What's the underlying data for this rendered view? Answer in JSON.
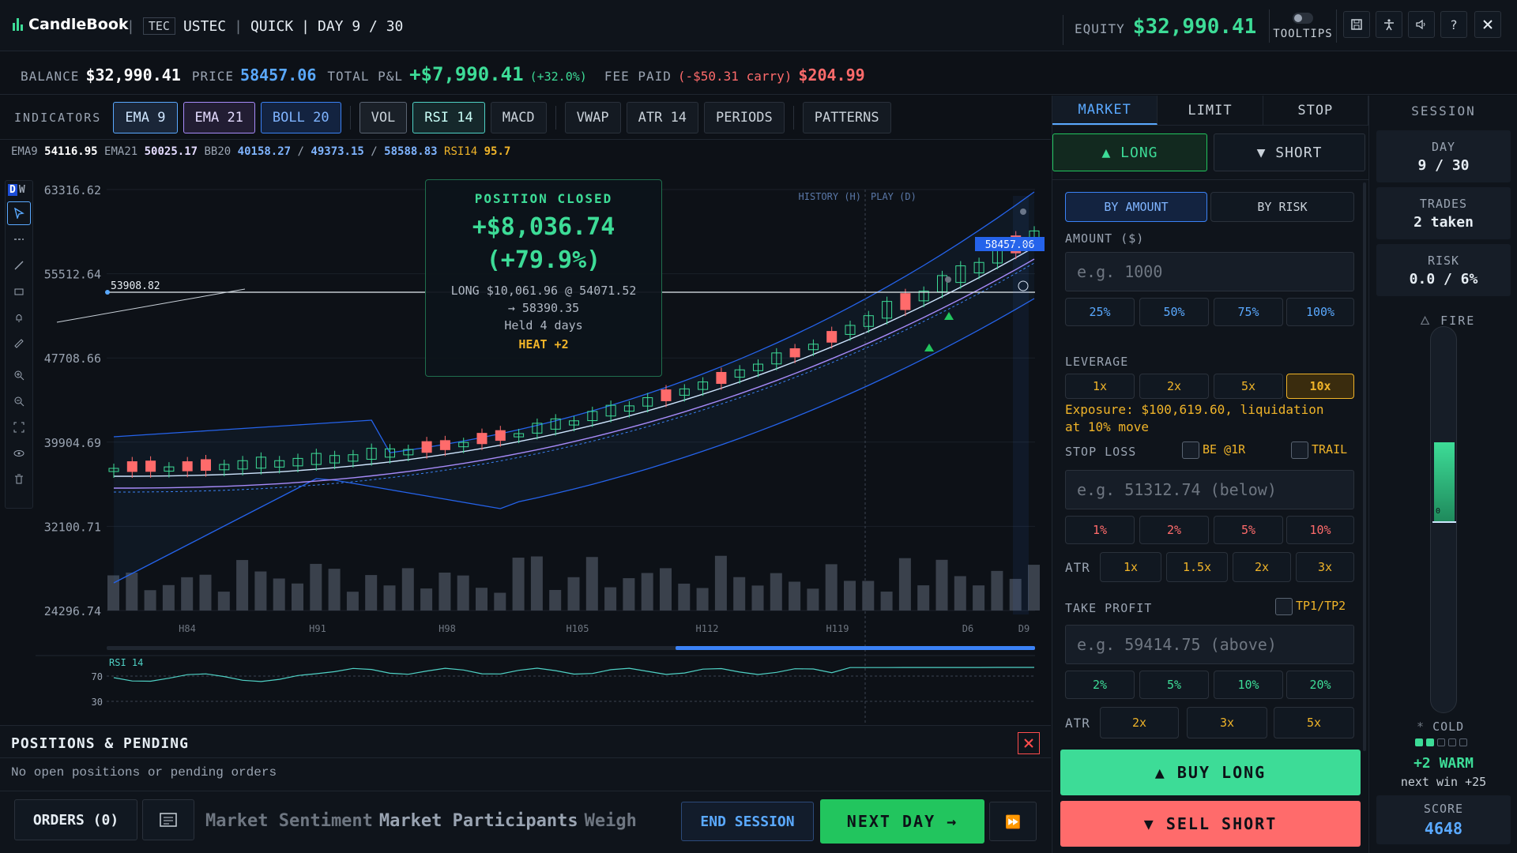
{
  "header": {
    "app_name": "CandleBook",
    "exchange_tag": "TEC",
    "symbol": "USTEC",
    "mode": "QUICK",
    "day_label": "DAY 9 / 30",
    "equity_label": "EQUITY",
    "equity_value": "$32,990.41",
    "tooltips_label": "TOOLTIPS",
    "icons": [
      "save-icon",
      "accessibility-icon",
      "sound-icon",
      "help-icon",
      "close-icon"
    ],
    "help_label": "?"
  },
  "stats": {
    "balance_label": "BALANCE",
    "balance": "$32,990.41",
    "price_label": "PRICE",
    "price": "58457.06",
    "pnl_label": "TOTAL P&L",
    "pnl": "+$7,990.41",
    "pnl_pct": "(+32.0%)",
    "fee_label": "FEE PAID",
    "fee_carry": "(-$50.31 carry)",
    "fee": "$204.99"
  },
  "indicators": {
    "label": "INDICATORS",
    "buttons": [
      "EMA 9",
      "EMA 21",
      "BOLL 20",
      "VOL",
      "RSI 14",
      "MACD",
      "VWAP",
      "ATR 14",
      "PERIODS",
      "PATTERNS"
    ]
  },
  "values": {
    "ema9_label": "EMA9",
    "ema9": "54116.95",
    "ema21_label": "EMA21",
    "ema21": "50025.17",
    "bb_label": "BB20",
    "bb_lo": "40158.27",
    "bb_mid": "49373.15",
    "bb_hi": "58588.83",
    "rsi_label": "RSI14",
    "rsi": "95.7",
    "sep": "/"
  },
  "tools": {
    "d": "D",
    "w": "W",
    "icons": [
      "cursor-icon",
      "horizontal-line-icon",
      "trendline-icon",
      "rectangle-icon",
      "alert-bell-icon",
      "ruler-icon",
      "zoom-in-icon",
      "zoom-out-icon",
      "fit-screen-icon",
      "eye-icon",
      "trash-icon"
    ]
  },
  "chart_data": {
    "type": "candlestick",
    "price_axis": [
      "63316.62",
      "55512.64",
      "47708.66",
      "39904.69",
      "32100.71",
      "24296.74"
    ],
    "x_ticks": [
      "H84",
      "H91",
      "H98",
      "H105",
      "H112",
      "H119",
      "D6",
      "D9"
    ],
    "hline_label": "53908.82",
    "current_price_label": "58457.06",
    "history_label": "HISTORY (H)",
    "play_label": "PLAY (D)",
    "rsi_label": "RSI 14",
    "rsi_levels": [
      "70",
      "30"
    ]
  },
  "close_card": {
    "title": "POSITION CLOSED",
    "pnl": "+$8,036.74",
    "pct": "(+79.9%)",
    "detail": "LONG $10,061.96 @ 54071.52",
    "exit": "→ 58390.35",
    "held": "Held 4 days",
    "heat": "HEAT +2"
  },
  "positions": {
    "title": "POSITIONS & PENDING",
    "empty": "No open positions or pending orders",
    "orders_button": "ORDERS (0)",
    "ticker_parts": [
      "Market Sentiment",
      "Market Participants",
      "Weigh"
    ],
    "end_session": "END SESSION",
    "next_day": "NEXT DAY →",
    "skip": "⏩"
  },
  "order_panel": {
    "tabs": [
      "MARKET",
      "LIMIT",
      "STOP"
    ],
    "long": "▲ LONG",
    "short": "▼ SHORT",
    "by_amount": "BY AMOUNT",
    "by_risk": "BY RISK",
    "amount_label": "AMOUNT ($)",
    "amount_placeholder": "e.g. 1000",
    "amount_chips": [
      "25%",
      "50%",
      "75%",
      "100%"
    ],
    "leverage_label": "LEVERAGE",
    "leverage_chips": [
      "1x",
      "2x",
      "5x",
      "10x"
    ],
    "exposure_line1": "Exposure: $100,619.60, liquidation",
    "exposure_line2": "at 10% move",
    "stop_label": "STOP LOSS",
    "be_label": "BE @1R",
    "trail_label": "TRAIL",
    "stop_placeholder": "e.g. 51312.74 (below)",
    "stop_chips": [
      "1%",
      "2%",
      "5%",
      "10%"
    ],
    "atr_label": "ATR",
    "stop_atr_chips": [
      "1x",
      "1.5x",
      "2x",
      "3x"
    ],
    "tp_label": "TAKE PROFIT",
    "tp1tp2_label": "TP1/TP2",
    "tp_placeholder": "e.g. 59414.75 (above)",
    "tp_chips": [
      "2%",
      "5%",
      "10%",
      "20%"
    ],
    "tp_atr_chips": [
      "2x",
      "3x",
      "5x"
    ],
    "buy_long": "▲ BUY LONG",
    "sell_short": "▼ SELL SHORT"
  },
  "session": {
    "title": "SESSION",
    "day_label": "DAY",
    "day": "9 / 30",
    "trades_label": "TRADES",
    "trades": "2 taken",
    "risk_label": "RISK",
    "risk": "0.0 / 6%",
    "fire_label": "FIRE",
    "gauge_value": "0",
    "cold_label": "COLD",
    "warm": "+2 WARM",
    "next_win": "next win +25",
    "score_label": "SCORE",
    "score": "4648"
  }
}
